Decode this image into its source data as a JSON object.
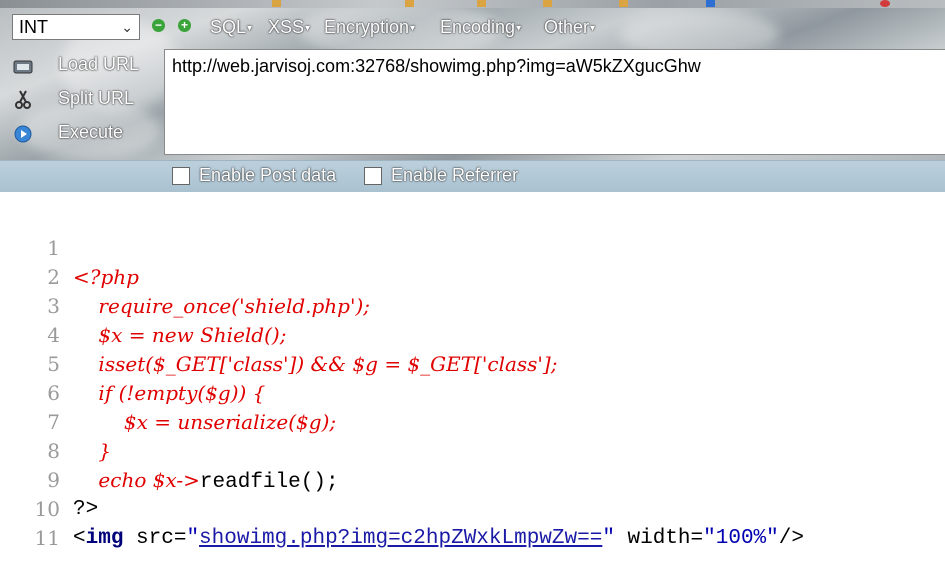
{
  "toolbar": {
    "type_select_value": "INT",
    "menus": [
      "SQL",
      "XSS",
      "Encryption",
      "Encoding",
      "Other"
    ],
    "side_buttons": [
      "Load URL",
      "Split URL",
      "Execute"
    ],
    "url_value": "http://web.jarvisoj.com:32768/showimg.php?img=aW5kZXgucGhw",
    "enable_post_label": "Enable Post data",
    "enable_referrer_label": "Enable Referrer",
    "icons": [
      "minus-icon",
      "plus-icon",
      "load-url-icon",
      "split-url-icon",
      "execute-icon"
    ]
  },
  "code": {
    "line_numbers": [
      "1",
      "2",
      "3",
      "4",
      "5",
      "6",
      "7",
      "8",
      "9",
      "10",
      "11"
    ],
    "l1": "<?php",
    "l2": "    require_once('shield.php');",
    "l3": "    $x = new Shield();",
    "l4": "    isset($_GET['class']) && $g = $_GET['class'];",
    "l5": "    if (!empty($g)) {",
    "l6": "        $x = unserialize($g);",
    "l7": "    }",
    "l8_php": "    echo $x->",
    "l8_rest": "readfile();",
    "l9": "?>",
    "l10_open": "<",
    "l10_tag": "img",
    "l10_src_attr": " src=",
    "l10_q1": "\"",
    "l10_src_val": "showimg.php?img=c2hpZWxkLmpwZw==",
    "l10_q2": "\"",
    "l10_width_attr": " width=",
    "l10_width_val": "\"100%\"",
    "l10_close": "/>"
  },
  "colors": {
    "php_code": "#e00000",
    "line_number": "#9a9a9a",
    "link": "#1a1aa6"
  }
}
